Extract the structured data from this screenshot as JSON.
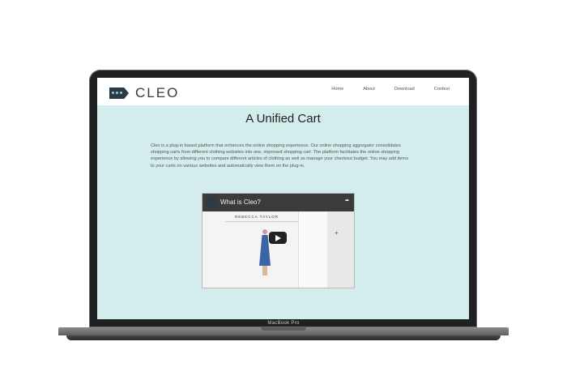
{
  "header": {
    "logo_text": "CLEO",
    "nav": [
      "Home",
      "About",
      "Download",
      "Contest"
    ]
  },
  "main": {
    "title": "A Unified Cart",
    "description": "Cleo is a plug-in based platform that enhances the online shopping experience. Our online shopping aggregator consolidates shopping carts from different clothing websites into one, improved shopping cart. The platform facilitates the online shopping experience by allowing you to compare different articles of clothing as well as manage your checkout budget. You may add items to your carts on various websites and automatically view them on the plug-in."
  },
  "video": {
    "title": "What is Cleo?",
    "brand": "REBECCA TAYLOR"
  },
  "device": {
    "model": "MacBook Pro"
  },
  "colors": {
    "page_background": "#d3edec",
    "logo_dark": "#2b3a44",
    "logo_accent": "#8fd3cc"
  }
}
